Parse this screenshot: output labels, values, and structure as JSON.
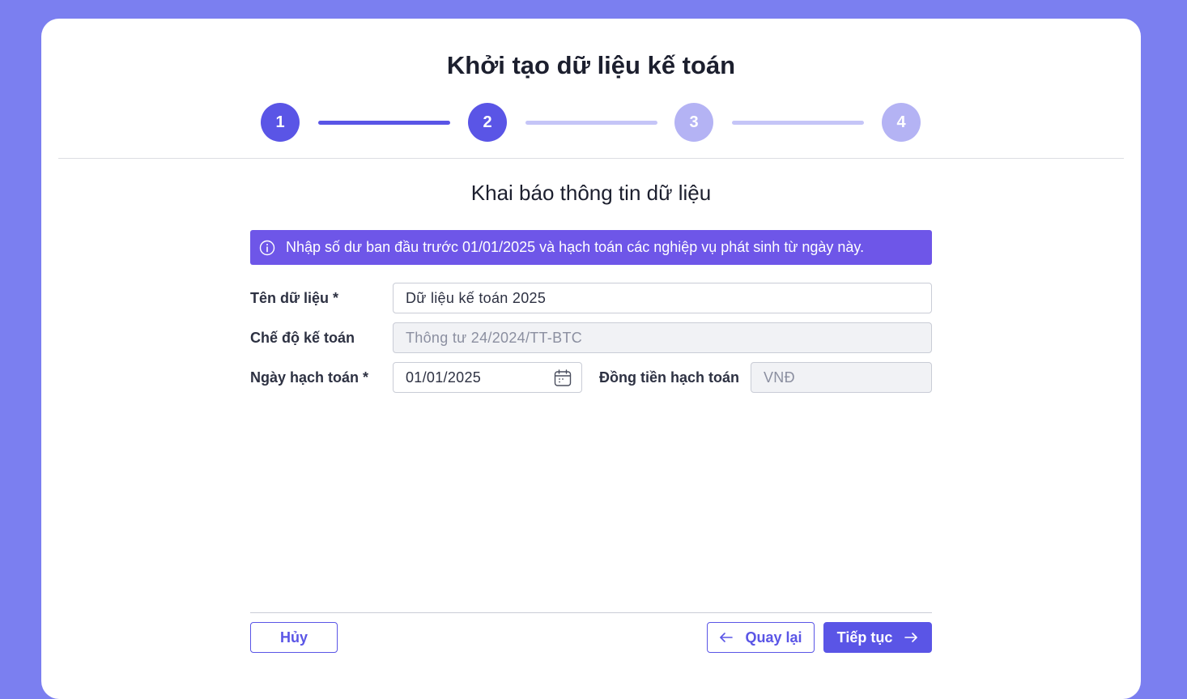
{
  "page_title": "Khởi tạo dữ liệu kế toán",
  "stepper": {
    "steps": [
      {
        "label": "1",
        "state": "active"
      },
      {
        "label": "2",
        "state": "active"
      },
      {
        "label": "3",
        "state": "inactive"
      },
      {
        "label": "4",
        "state": "inactive"
      }
    ],
    "current_step": 2
  },
  "section_title": "Khai báo thông tin dữ liệu",
  "info_banner": {
    "icon": "info-icon",
    "text": "Nhập số dư ban đầu trước 01/01/2025 và hạch toán các nghiệp vụ phát sinh từ ngày này."
  },
  "form": {
    "data_name": {
      "label": "Tên dữ liệu *",
      "value": "Dữ liệu kế toán 2025"
    },
    "accounting_regime": {
      "label": "Chế độ kế toán",
      "value": "Thông tư 24/2024/TT-BTC"
    },
    "accounting_date": {
      "label": "Ngày hạch toán *",
      "value": "01/01/2025",
      "icon": "calendar-icon"
    },
    "currency": {
      "label": "Đồng tiền hạch toán",
      "value": "VNĐ"
    }
  },
  "footer": {
    "cancel_label": "Hủy",
    "back_label": "Quay lại",
    "next_label": "Tiếp tục"
  },
  "colors": {
    "background": "#7b7ff0",
    "accent": "#5a55e6",
    "banner": "#6e56e8",
    "inactive_step": "#b4b3f4"
  }
}
